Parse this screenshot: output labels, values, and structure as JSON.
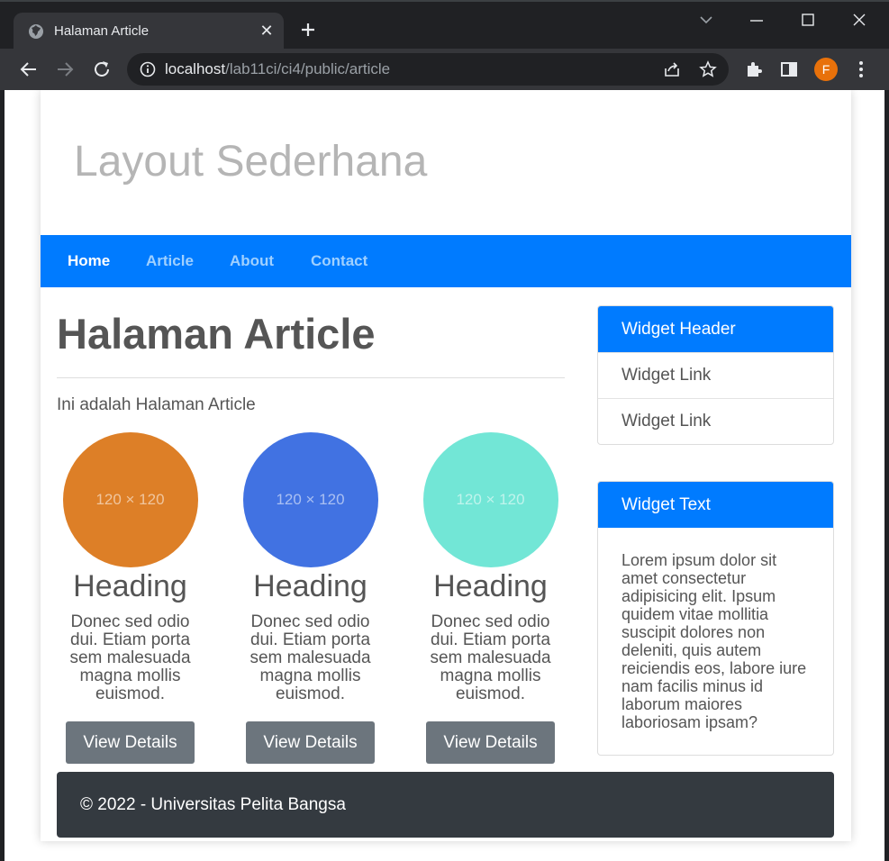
{
  "browser": {
    "tab_title": "Halaman Article",
    "url_host": "localhost",
    "url_path": "/lab11ci/ci4/public/article",
    "profile_initial": "F"
  },
  "site": {
    "title": "Layout Sederhana",
    "nav": [
      {
        "label": "Home",
        "active": true
      },
      {
        "label": "Article",
        "active": false
      },
      {
        "label": "About",
        "active": false
      },
      {
        "label": "Contact",
        "active": false
      }
    ]
  },
  "main": {
    "heading": "Halaman Article",
    "intro": "Ini adalah Halaman Article",
    "cards": [
      {
        "placeholder": "120 × 120",
        "color": "#dd7f27",
        "heading": "Heading",
        "text": "Donec sed odio dui. Etiam porta sem malesuada magna mollis euismod.",
        "button": "View Details"
      },
      {
        "placeholder": "120 × 120",
        "color": "#4172e2",
        "heading": "Heading",
        "text": "Donec sed odio dui. Etiam porta sem malesuada magna mollis euismod.",
        "button": "View Details"
      },
      {
        "placeholder": "120 × 120",
        "color": "#72e6d6",
        "heading": "Heading",
        "text": "Donec sed odio dui. Etiam porta sem malesuada magna mollis euismod.",
        "button": "View Details"
      }
    ]
  },
  "sidebar": {
    "widget_links": {
      "header": "Widget Header",
      "links": [
        "Widget Link",
        "Widget Link"
      ]
    },
    "widget_text": {
      "header": "Widget Text",
      "body": "Lorem ipsum dolor sit amet consectetur adipisicing elit. Ipsum quidem vitae mollitia suscipit dolores non deleniti, quis autem reiciendis eos, labore iure nam facilis minus id laborum maiores laboriosam ipsam?"
    }
  },
  "footer": {
    "text": "© 2022 - Universitas Pelita Bangsa"
  },
  "colors": {
    "primary": "#007bff",
    "secondary": "#6c757d",
    "footer": "#343a40"
  }
}
